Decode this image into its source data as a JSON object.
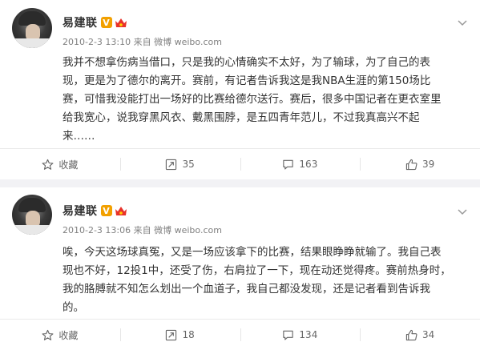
{
  "posts": [
    {
      "username": "易建联",
      "verified_badge": "V",
      "meta": "2010-2-3 13:10 来自 微博 weibo.com",
      "lines": [
        "我并不想拿伤病当借口，只是我的心情确实不太好，为了输球，为了自己的表",
        "现，更是为了德尔的离开。赛前，有记者告诉我这是我NBA生涯的第150场比",
        "赛，可惜我没能打出一场好的比赛给德尔送行。赛后，很多中国记者在更衣室里",
        "给我宽心，说我穿黑风衣、戴黑围脖，是五四青年范儿，不过我真高兴不起",
        "来……"
      ],
      "actions": {
        "favorite": "收藏",
        "repost": "35",
        "comment": "163",
        "like": "39"
      }
    },
    {
      "username": "易建联",
      "verified_badge": "V",
      "meta": "2010-2-3 13:06 来自 微博 weibo.com",
      "lines": [
        "唉，今天这场球真冤，又是一场应该拿下的比赛，结果眼睁睁就输了。我自己表",
        "现也不好，12投1中，还受了伤，右肩拉了一下，现在动还觉得疼。赛前热身时，",
        "我的胳膊就不知怎么划出一个血道子，我自己都没发现，还是记者看到告诉我",
        "的。"
      ],
      "actions": {
        "favorite": "收藏",
        "repost": "18",
        "comment": "134",
        "like": "34"
      }
    }
  ],
  "colors": {
    "badge": "#f2a000",
    "crown": "#e8312a",
    "background": "#f2f2f5"
  },
  "icons": [
    "chevron-down-icon",
    "star-icon",
    "repost-icon",
    "comment-icon",
    "like-icon",
    "crown-icon"
  ]
}
